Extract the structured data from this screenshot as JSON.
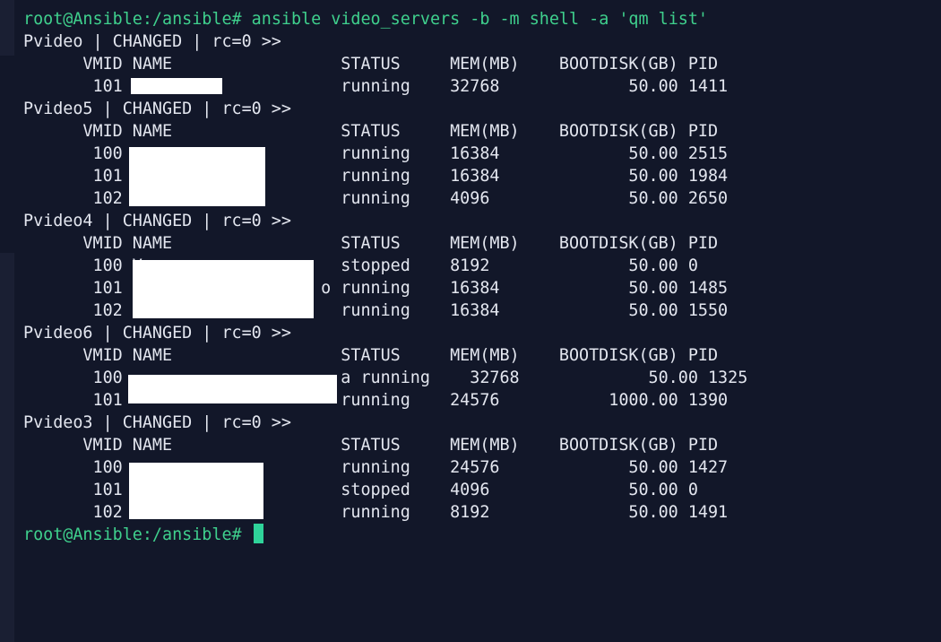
{
  "colors": {
    "background": "#121729",
    "text": "#e3e6ef",
    "prompt": "#3fd08d",
    "cursor": "#2fd39a",
    "redaction": "#ffffff"
  },
  "terminal": {
    "command_prompt": "root@Ansible:/ansible#",
    "command": "ansible video_servers -b -m shell -a 'qm list'",
    "final_prompt": "root@Ansible:/ansible#",
    "output": {
      "h1": "Pvideo | CHANGED | rc=0 >>",
      "c1": "      VMID NAME                 STATUS     MEM(MB)    BOOTDISK(GB) PID",
      "r1_1": "       101                      running    32768             50.00 1411",
      "h2": "Pvideo5 | CHANGED | rc=0 >>",
      "c2": "      VMID NAME                 STATUS     MEM(MB)    BOOTDISK(GB) PID",
      "r2_1": "       100                      running    16384             50.00 2515",
      "r2_2": "       101                      running    16384             50.00 1984",
      "r2_3": "       102                      running    4096              50.00 2650",
      "h3": "Pvideo4 | CHANGED | rc=0 >>",
      "c3": "      VMID NAME                 STATUS     MEM(MB)    BOOTDISK(GB) PID",
      "r3_1": "       100 V                    stopped    8192              50.00 0",
      "r3_2": "       101 V                  o running    16384             50.00 1485",
      "r3_3": "       102 V                    running    16384             50.00 1550",
      "h4": "Pvideo6 | CHANGED | rc=0 >>",
      "c4": "      VMID NAME                 STATUS     MEM(MB)    BOOTDISK(GB) PID",
      "r4_1": "       100                      a running    32768             50.00 1325",
      "r4_2": "       101                      running    24576           1000.00 1390",
      "h5": "Pvideo3 | CHANGED | rc=0 >>",
      "c5": "      VMID NAME                 STATUS     MEM(MB)    BOOTDISK(GB) PID",
      "r5_1": "       100                      running    24576             50.00 1427",
      "r5_2": "       101                      stopped    4096              50.00 0",
      "r5_3": "       102                      running    8192              50.00 1491"
    }
  }
}
